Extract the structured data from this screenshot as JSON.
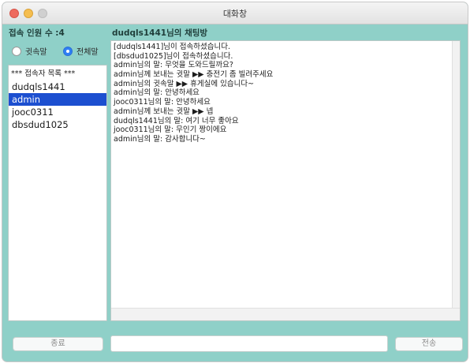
{
  "window": {
    "title": "대화창"
  },
  "header": {
    "users_count": "접속 인원 수 :4",
    "room_title": "dudqls1441님의 채팅방"
  },
  "filters": {
    "options": [
      {
        "label": "귓속말",
        "checked": false
      },
      {
        "label": "전체말",
        "checked": true
      }
    ]
  },
  "user_list": {
    "header": "*** 접속자 목록 ***",
    "users": [
      "dudqls1441",
      "admin",
      "jooc0311",
      "dbsdud1025"
    ],
    "selected": "admin"
  },
  "chat": {
    "lines": [
      "[dudqls1441]님이 접속하셨습니다.",
      "[dbsdud1025]님이 접속하셨습니다.",
      "admin님의 말: 무엇을 도와드릴까요?",
      "admin님께 보내는 귓말 ▶▶ 충전기 좀 빌려주세요",
      "admin님의 귓속말 ▶▶ 휴게실에 있습니다~",
      "admin님의 말: 안녕하세요",
      "jooc0311님의 말: 안녕하세요",
      "admin님께 보내는 귓말 ▶▶ 넵",
      "dudqls1441님의 말: 여기 너무 좋아요",
      "jooc0311님의 말: 무인기 짱이에요",
      "admin님의 말: 감사합니다~"
    ]
  },
  "input": {
    "value": ""
  },
  "buttons": {
    "exit_label": "종료",
    "send_label": "전송"
  },
  "colors": {
    "window_bg": "#8fd0c8",
    "selection": "#1c4fd0",
    "radio_checked": "#2f7ff5"
  }
}
